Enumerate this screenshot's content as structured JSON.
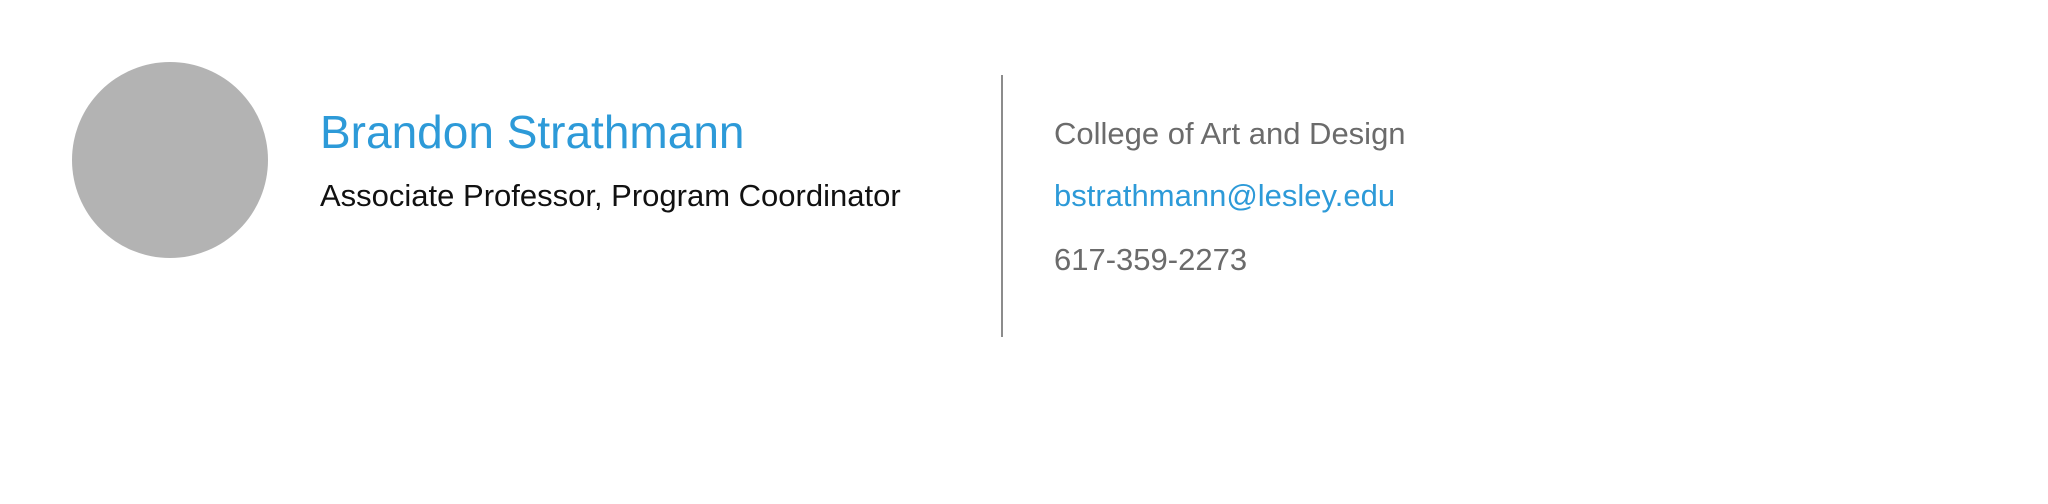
{
  "profile": {
    "avatar_icon": "person-photo-placeholder",
    "name": "Brandon Strathmann",
    "role": "Associate Professor, Program Coordinator"
  },
  "contact": {
    "college": "College of Art and Design",
    "email": "bstrathmann@lesley.edu",
    "phone": "617-359-2273"
  },
  "colors": {
    "accent": "#2d9ad8",
    "secondary_text": "#6b6b6b",
    "avatar_fill": "#b3b3b3",
    "divider": "#8c8c8c"
  }
}
